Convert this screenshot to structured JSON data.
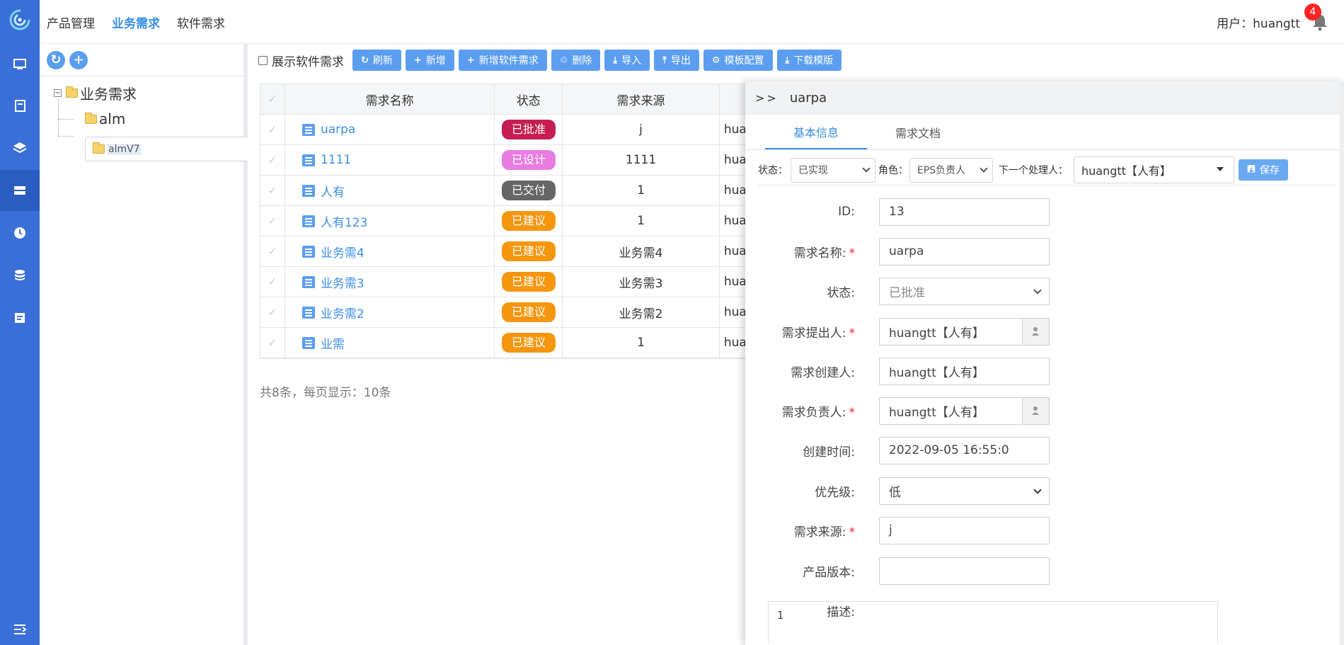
{
  "nav": {
    "items": [
      "产品管理",
      "业务需求",
      "软件需求"
    ],
    "active_index": 1
  },
  "user": {
    "label": "用户：huangtt",
    "notification_count": "4"
  },
  "sidebar": {
    "icons": [
      "monitor-icon",
      "book-icon",
      "layers-icon",
      "server-icon",
      "clock-icon",
      "database-icon",
      "report-icon",
      "menu-collapse-icon"
    ],
    "active_index": 3
  },
  "tree": {
    "root": "业务需求",
    "children": [
      "alm",
      "almV7"
    ],
    "selected": "almV7"
  },
  "toolbar": {
    "show_software_label": "展示软件需求",
    "buttons": [
      "刷新",
      "新增",
      "新增软件需求",
      "删除",
      "导入",
      "导出",
      "模板配置",
      "下载模版"
    ]
  },
  "table": {
    "columns": [
      "需求名称",
      "状态",
      "需求来源"
    ],
    "rows": [
      {
        "name": "uarpa",
        "status": "已批准",
        "status_color": "#c51d52",
        "source": "j",
        "owner": "hua"
      },
      {
        "name": "1111",
        "status": "已设计",
        "status_color": "#e87ce0",
        "source": "1111",
        "owner": "hua"
      },
      {
        "name": "人有",
        "status": "已交付",
        "status_color": "#666666",
        "source": "1",
        "owner": "hua"
      },
      {
        "name": "人有123",
        "status": "已建议",
        "status_color": "#f5960f",
        "source": "1",
        "owner": "hua"
      },
      {
        "name": "业务需4",
        "status": "已建议",
        "status_color": "#f5960f",
        "source": "业务需4",
        "owner": "hua"
      },
      {
        "name": "业务需3",
        "status": "已建议",
        "status_color": "#f5960f",
        "source": "业务需3",
        "owner": "hua"
      },
      {
        "name": "业务需2",
        "status": "已建议",
        "status_color": "#f5960f",
        "source": "业务需2",
        "owner": "hua"
      },
      {
        "name": "业需",
        "status": "已建议",
        "status_color": "#f5960f",
        "source": "1",
        "owner": "hua"
      }
    ],
    "pager": "共8条，每页显示：10条"
  },
  "detail": {
    "arrow": ">>",
    "title": "uarpa",
    "tabs": [
      "基本信息",
      "需求文档"
    ],
    "status_label": "状态：",
    "status_value": "已实现",
    "role_label": "角色：",
    "role_value": "EPS负责人",
    "next_label": "下一个处理人：",
    "next_value": "huangtt【人有】",
    "save_label": "保存",
    "fields": {
      "id": {
        "label": "ID:",
        "value": "13"
      },
      "name": {
        "label": "需求名称:",
        "value": "uarpa"
      },
      "status": {
        "label": "状态:",
        "value": "已批准"
      },
      "proposer": {
        "label": "需求提出人:",
        "value": "huangtt【人有】"
      },
      "creator": {
        "label": "需求创建人:",
        "value": "huangtt【人有】"
      },
      "owner": {
        "label": "需求负责人:",
        "value": "huangtt【人有】"
      },
      "created": {
        "label": "创建时间:",
        "value": "2022-09-05 16:55:0"
      },
      "priority": {
        "label": "优先级:",
        "value": "低"
      },
      "source": {
        "label": "需求来源:",
        "value": "j"
      },
      "version": {
        "label": "产品版本:",
        "value": ""
      },
      "desc": {
        "label": "描述:",
        "value": "1"
      }
    }
  },
  "colors": {
    "rail": "#3a6fd8",
    "accent": "#3b8fe6",
    "button": "#5b9ef0"
  }
}
